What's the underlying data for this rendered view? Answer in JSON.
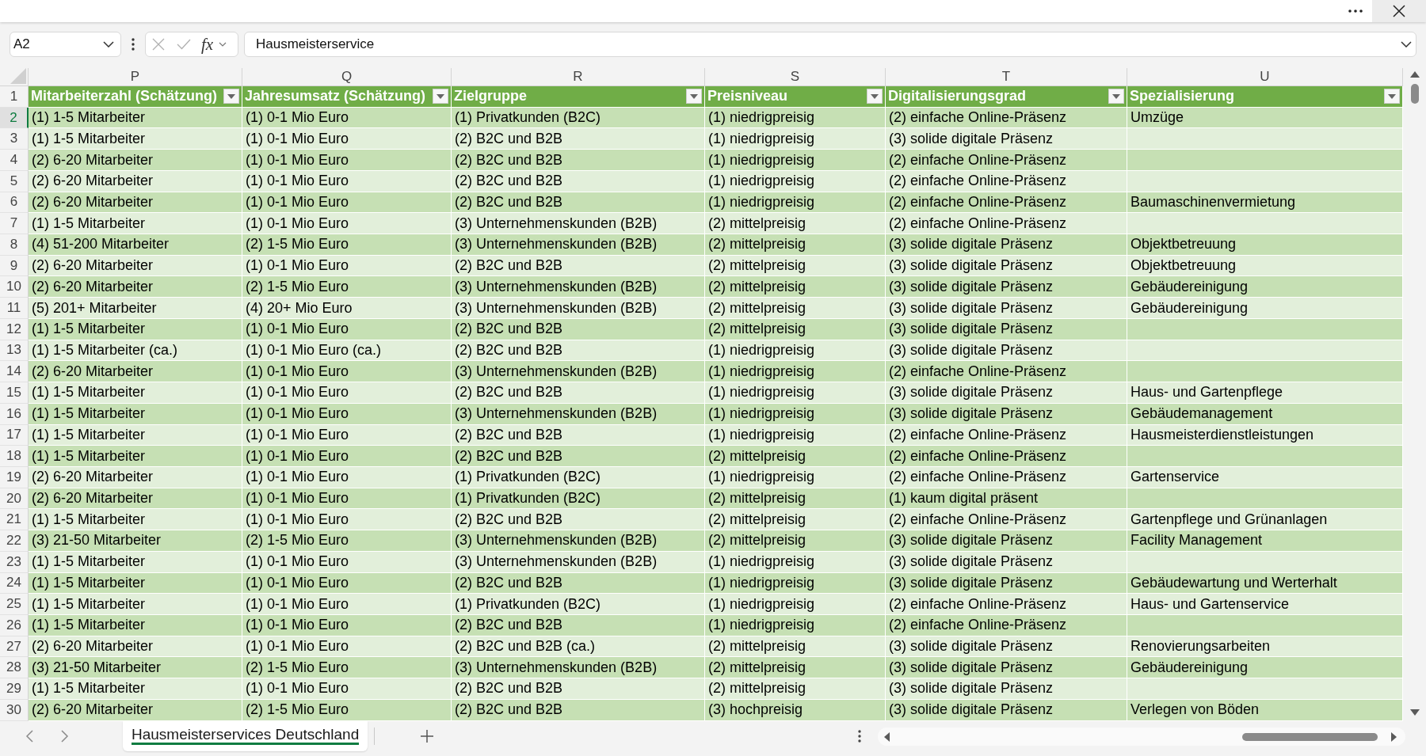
{
  "formula_bar": {
    "name_box": "A2",
    "function_button": "fx",
    "formula": "Hausmeisterservice"
  },
  "sheet": {
    "header_row_number": "1",
    "columns": [
      {
        "letter": "P",
        "title": "Mitarbeiterzahl (Schätzung)"
      },
      {
        "letter": "Q",
        "title": "Jahresumsatz (Schätzung)"
      },
      {
        "letter": "R",
        "title": "Zielgruppe"
      },
      {
        "letter": "S",
        "title": "Preisniveau"
      },
      {
        "letter": "T",
        "title": "Digitalisierungsgrad"
      },
      {
        "letter": "U",
        "title": "Spezialisierung"
      }
    ],
    "rows": [
      {
        "number": "2",
        "selected": true,
        "cells": [
          "(1) 1-5 Mitarbeiter",
          "(1) 0-1 Mio Euro",
          "(1) Privatkunden (B2C)",
          "(1) niedrigpreisig",
          "(2) einfache Online-Präsenz",
          "Umzüge"
        ]
      },
      {
        "number": "3",
        "selected": false,
        "cells": [
          "(1) 1-5 Mitarbeiter",
          "(1) 0-1 Mio Euro",
          "(2) B2C und B2B",
          "(1) niedrigpreisig",
          "(3) solide digitale Präsenz"
        ]
      },
      {
        "number": "4",
        "selected": false,
        "cells": [
          "(2) 6-20 Mitarbeiter",
          "(1) 0-1 Mio Euro",
          "(2) B2C und B2B",
          "(1) niedrigpreisig",
          "(2) einfache Online-Präsenz"
        ]
      },
      {
        "number": "5",
        "selected": false,
        "cells": [
          "(2) 6-20 Mitarbeiter",
          "(1) 0-1 Mio Euro",
          "(2) B2C und B2B",
          "(1) niedrigpreisig",
          "(2) einfache Online-Präsenz"
        ]
      },
      {
        "number": "6",
        "selected": false,
        "cells": [
          "(2) 6-20 Mitarbeiter",
          "(1) 0-1 Mio Euro",
          "(2) B2C und B2B",
          "(1) niedrigpreisig",
          "(2) einfache Online-Präsenz",
          "Baumaschinenvermietung"
        ]
      },
      {
        "number": "7",
        "selected": false,
        "cells": [
          "(1) 1-5 Mitarbeiter",
          "(1) 0-1 Mio Euro",
          "(3) Unternehmenskunden (B2B)",
          "(2) mittelpreisig",
          "(2) einfache Online-Präsenz"
        ]
      },
      {
        "number": "8",
        "selected": false,
        "cells": [
          "(4) 51-200 Mitarbeiter",
          "(2) 1-5 Mio Euro",
          "(3) Unternehmenskunden (B2B)",
          "(2) mittelpreisig",
          "(3) solide digitale Präsenz",
          "Objektbetreuung"
        ]
      },
      {
        "number": "9",
        "selected": false,
        "cells": [
          "(2) 6-20 Mitarbeiter",
          "(1) 0-1 Mio Euro",
          "(2) B2C und B2B",
          "(2) mittelpreisig",
          "(3) solide digitale Präsenz",
          "Objektbetreuung"
        ]
      },
      {
        "number": "10",
        "selected": false,
        "cells": [
          "(2) 6-20 Mitarbeiter",
          "(2) 1-5 Mio Euro",
          "(3) Unternehmenskunden (B2B)",
          "(2) mittelpreisig",
          "(3) solide digitale Präsenz",
          "Gebäudereinigung"
        ]
      },
      {
        "number": "11",
        "selected": false,
        "cells": [
          "(5) 201+ Mitarbeiter",
          "(4) 20+ Mio Euro",
          "(3) Unternehmenskunden (B2B)",
          "(2) mittelpreisig",
          "(3) solide digitale Präsenz",
          "Gebäudereinigung"
        ]
      },
      {
        "number": "12",
        "selected": false,
        "cells": [
          "(1) 1-5 Mitarbeiter",
          "(1) 0-1 Mio Euro",
          "(2) B2C und B2B",
          "(2) mittelpreisig",
          "(3) solide digitale Präsenz"
        ]
      },
      {
        "number": "13",
        "selected": false,
        "cells": [
          "(1) 1-5 Mitarbeiter (ca.)",
          "(1) 0-1 Mio Euro (ca.)",
          "(2) B2C und B2B",
          "(1) niedrigpreisig",
          "(3) solide digitale Präsenz"
        ]
      },
      {
        "number": "14",
        "selected": false,
        "cells": [
          "(2) 6-20 Mitarbeiter",
          "(1) 0-1 Mio Euro",
          "(3) Unternehmenskunden (B2B)",
          "(1) niedrigpreisig",
          "(2) einfache Online-Präsenz"
        ]
      },
      {
        "number": "15",
        "selected": false,
        "cells": [
          "(1) 1-5 Mitarbeiter",
          "(1) 0-1 Mio Euro",
          "(2) B2C und B2B",
          "(1) niedrigpreisig",
          "(3) solide digitale Präsenz",
          "Haus- und Gartenpflege"
        ]
      },
      {
        "number": "16",
        "selected": false,
        "cells": [
          "(1) 1-5 Mitarbeiter",
          "(1) 0-1 Mio Euro",
          "(3) Unternehmenskunden (B2B)",
          "(1) niedrigpreisig",
          "(3) solide digitale Präsenz",
          "Gebäudemanagement"
        ]
      },
      {
        "number": "17",
        "selected": false,
        "cells": [
          "(1) 1-5 Mitarbeiter",
          "(1) 0-1 Mio Euro",
          "(2) B2C und B2B",
          "(1) niedrigpreisig",
          "(2) einfache Online-Präsenz",
          "Hausmeisterdienstleistungen"
        ]
      },
      {
        "number": "18",
        "selected": false,
        "cells": [
          "(1) 1-5 Mitarbeiter",
          "(1) 0-1 Mio Euro",
          "(2) B2C und B2B",
          "(2) mittelpreisig",
          "(2) einfache Online-Präsenz"
        ]
      },
      {
        "number": "19",
        "selected": false,
        "cells": [
          "(2) 6-20 Mitarbeiter",
          "(1) 0-1 Mio Euro",
          "(1) Privatkunden (B2C)",
          "(1) niedrigpreisig",
          "(2) einfache Online-Präsenz",
          "Gartenservice"
        ]
      },
      {
        "number": "20",
        "selected": false,
        "cells": [
          "(2) 6-20 Mitarbeiter",
          "(1) 0-1 Mio Euro",
          "(1) Privatkunden (B2C)",
          "(2) mittelpreisig",
          "(1) kaum digital präsent"
        ]
      },
      {
        "number": "21",
        "selected": false,
        "cells": [
          "(1) 1-5 Mitarbeiter",
          "(1) 0-1 Mio Euro",
          "(2) B2C und B2B",
          "(2) mittelpreisig",
          "(2) einfache Online-Präsenz",
          "Gartenpflege und Grünanlagen"
        ]
      },
      {
        "number": "22",
        "selected": false,
        "cells": [
          "(3) 21-50 Mitarbeiter",
          "(2) 1-5 Mio Euro",
          "(3) Unternehmenskunden (B2B)",
          "(2) mittelpreisig",
          "(3) solide digitale Präsenz",
          "Facility Management"
        ]
      },
      {
        "number": "23",
        "selected": false,
        "cells": [
          "(1) 1-5 Mitarbeiter",
          "(1) 0-1 Mio Euro",
          "(3) Unternehmenskunden (B2B)",
          "(1) niedrigpreisig",
          "(3) solide digitale Präsenz"
        ]
      },
      {
        "number": "24",
        "selected": false,
        "cells": [
          "(1) 1-5 Mitarbeiter",
          "(1) 0-1 Mio Euro",
          "(2) B2C und B2B",
          "(1) niedrigpreisig",
          "(3) solide digitale Präsenz",
          "Gebäudewartung und Werterhalt"
        ]
      },
      {
        "number": "25",
        "selected": false,
        "cells": [
          "(1) 1-5 Mitarbeiter",
          "(1) 0-1 Mio Euro",
          "(1) Privatkunden (B2C)",
          "(1) niedrigpreisig",
          "(2) einfache Online-Präsenz",
          "Haus- und Gartenservice"
        ]
      },
      {
        "number": "26",
        "selected": false,
        "cells": [
          "(1) 1-5 Mitarbeiter",
          "(1) 0-1 Mio Euro",
          "(2) B2C und B2B",
          "(1) niedrigpreisig",
          "(2) einfache Online-Präsenz"
        ]
      },
      {
        "number": "27",
        "selected": false,
        "cells": [
          "(2) 6-20 Mitarbeiter",
          "(1) 0-1 Mio Euro",
          "(2) B2C und B2B (ca.)",
          "(2) mittelpreisig",
          "(3) solide digitale Präsenz",
          "Renovierungsarbeiten"
        ]
      },
      {
        "number": "28",
        "selected": false,
        "cells": [
          "(3) 21-50 Mitarbeiter",
          "(2) 1-5 Mio Euro",
          "(3) Unternehmenskunden (B2B)",
          "(2) mittelpreisig",
          "(3) solide digitale Präsenz",
          "Gebäudereinigung"
        ]
      },
      {
        "number": "29",
        "selected": false,
        "cells": [
          "(1) 1-5 Mitarbeiter",
          "(1) 0-1 Mio Euro",
          "(2) B2C und B2B",
          "(2) mittelpreisig",
          "(3) solide digitale Präsenz"
        ]
      },
      {
        "number": "30",
        "selected": false,
        "cells": [
          "(2) 6-20 Mitarbeiter",
          "(2) 1-5 Mio Euro",
          "(2) B2C und B2B",
          "(3) hochpreisig",
          "(3) solide digitale Präsenz",
          "Verlegen von Böden"
        ]
      }
    ]
  },
  "sheet_tabs": [
    {
      "label": "Hausmeisterservices Deutschland",
      "selected": true
    }
  ]
}
